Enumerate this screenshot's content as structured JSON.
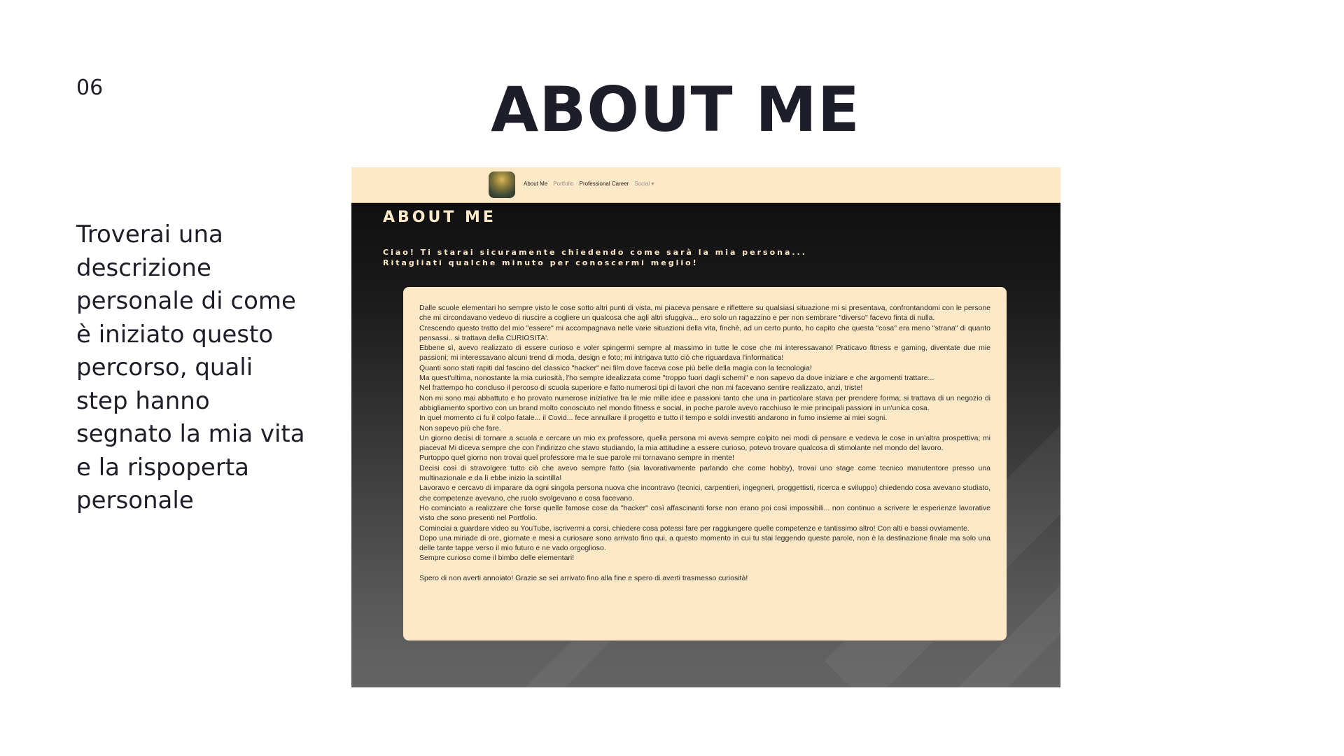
{
  "slide": {
    "number": "06",
    "title": "ABOUT ME",
    "description": "Troverai una descrizione personale di come è iniziato questo percorso, quali step hanno segnato la mia vita e la rispoperta personale"
  },
  "website": {
    "nav": {
      "links": [
        {
          "label": "About Me"
        },
        {
          "label": "Portfolio"
        },
        {
          "label": "Professional Career"
        },
        {
          "label": "Social ▾"
        }
      ]
    },
    "heading": "ABOUT ME",
    "intro_line1": "Ciao! Ti starai sicuramente chiedendo come sarà la mia persona...",
    "intro_line2": "Ritagliati qualche minuto per conoscermi meglio!",
    "paragraphs": [
      "Dalle scuole elementari ho sempre visto le cose sotto altri punti di vista, mi piaceva pensare e riflettere su qualsiasi situazione mi si presentava, confrontandomi con le persone che mi circondavano vedevo di riuscire a cogliere un qualcosa che agli altri sfuggiva... ero solo un ragazzino e per non sembrare \"diverso\" facevo finta di nulla.",
      "Crescendo questo tratto del mio \"essere\" mi accompagnava nelle varie situazioni della vita, finchè, ad un certo punto, ho capito che questa \"cosa\" era meno \"strana\" di quanto pensassi.. si trattava della CURIOSITA'.",
      "Ebbene sì, avevo realizzato di essere curioso e voler spingermi sempre al massimo in tutte le cose che mi interessavano! Praticavo fitness e gaming, diventate due mie passioni; mi interessavano alcuni trend di moda, design e foto; mi intrigava tutto ciò che riguardava l'informatica!",
      "Quanti sono stati rapiti dal fascino del classico \"hacker\" nei film dove faceva cose più belle della magia con la tecnologia!",
      "Ma quest'ultima, nonostante la mia curiosità, l'ho sempre idealizzata come \"troppo fuori dagli schemi\" e non sapevo da dove iniziare e che argomenti trattare...",
      "Nel frattempo ho concluso il percoso di scuola superiore e fatto numerosi tipi di lavori che non mi facevano sentire realizzato, anzi, triste!",
      "Non mi sono mai abbattuto e ho provato numerose iniziative fra le mie mille idee e passioni tanto che una in particolare stava per prendere forma; si trattava di un negozio di abbigliamento sportivo con un brand molto conosciuto nel mondo fitness e social, in poche parole avevo racchiuso le mie principali passioni in un'unica cosa.",
      "In quel momento ci fu il colpo fatale... il Covid... fece annullare il progetto e tutto il tempo e soldi investiti andarono in fumo insieme ai miei sogni.",
      "Non sapevo più che fare.",
      "Un giorno decisi di tornare a scuola e cercare un mio ex professore, quella persona mi aveva sempre colpito nei modi di pensare e vedeva le cose in un'altra prospettiva; mi piaceva! Mi diceva sempre che con l'indirizzo che stavo studiando, la mia attitudine a essere curioso, potevo trovare qualcosa di stimolante nel mondo del lavoro.",
      "Purtoppo quel giorno non trovai quel professore ma le sue parole mi tornavano sempre in mente!",
      "Decisi così di stravolgere tutto ciò che avevo sempre fatto (sia lavorativamente parlando che come hobby), trovai uno stage come tecnico manutentore presso una multinazionale e da lì ebbe inizio la scintilla!",
      "Lavoravo e cercavo di imparare da ogni singola persona nuova che incontravo (tecnici, carpentieri, ingegneri, proggettisti, ricerca e sviluppo) chiedendo cosa avevano studiato, che competenze avevano, che ruolo svolgevano e cosa facevano.",
      "Ho cominciato a realizzare che forse quelle famose cose da \"hacker\" così affascinanti forse non erano poi così impossibili... non continuo a scrivere le esperienze lavorative visto che sono presenti nel Portfolio.",
      "Cominciai a guardare video su YouTube, iscrivermi a corsi, chiedere cosa potessi fare per raggiungere quelle competenze e tantissimo altro! Con alti e bassi ovviamente.",
      "Dopo una miriade di ore, giornate e mesi a curiosare sono arrivato fino qui, a questo momento in cui tu stai leggendo queste parole, non è la destinazione finale ma solo una delle tante tappe verso il mio futuro e ne vado orgoglioso.",
      "Sempre curioso come il bimbo delle elementari!"
    ],
    "closing": "Spero di non averti annoiato! Grazie se sei arrivato fino alla fine e spero di averti trasmesso curiosità!"
  }
}
